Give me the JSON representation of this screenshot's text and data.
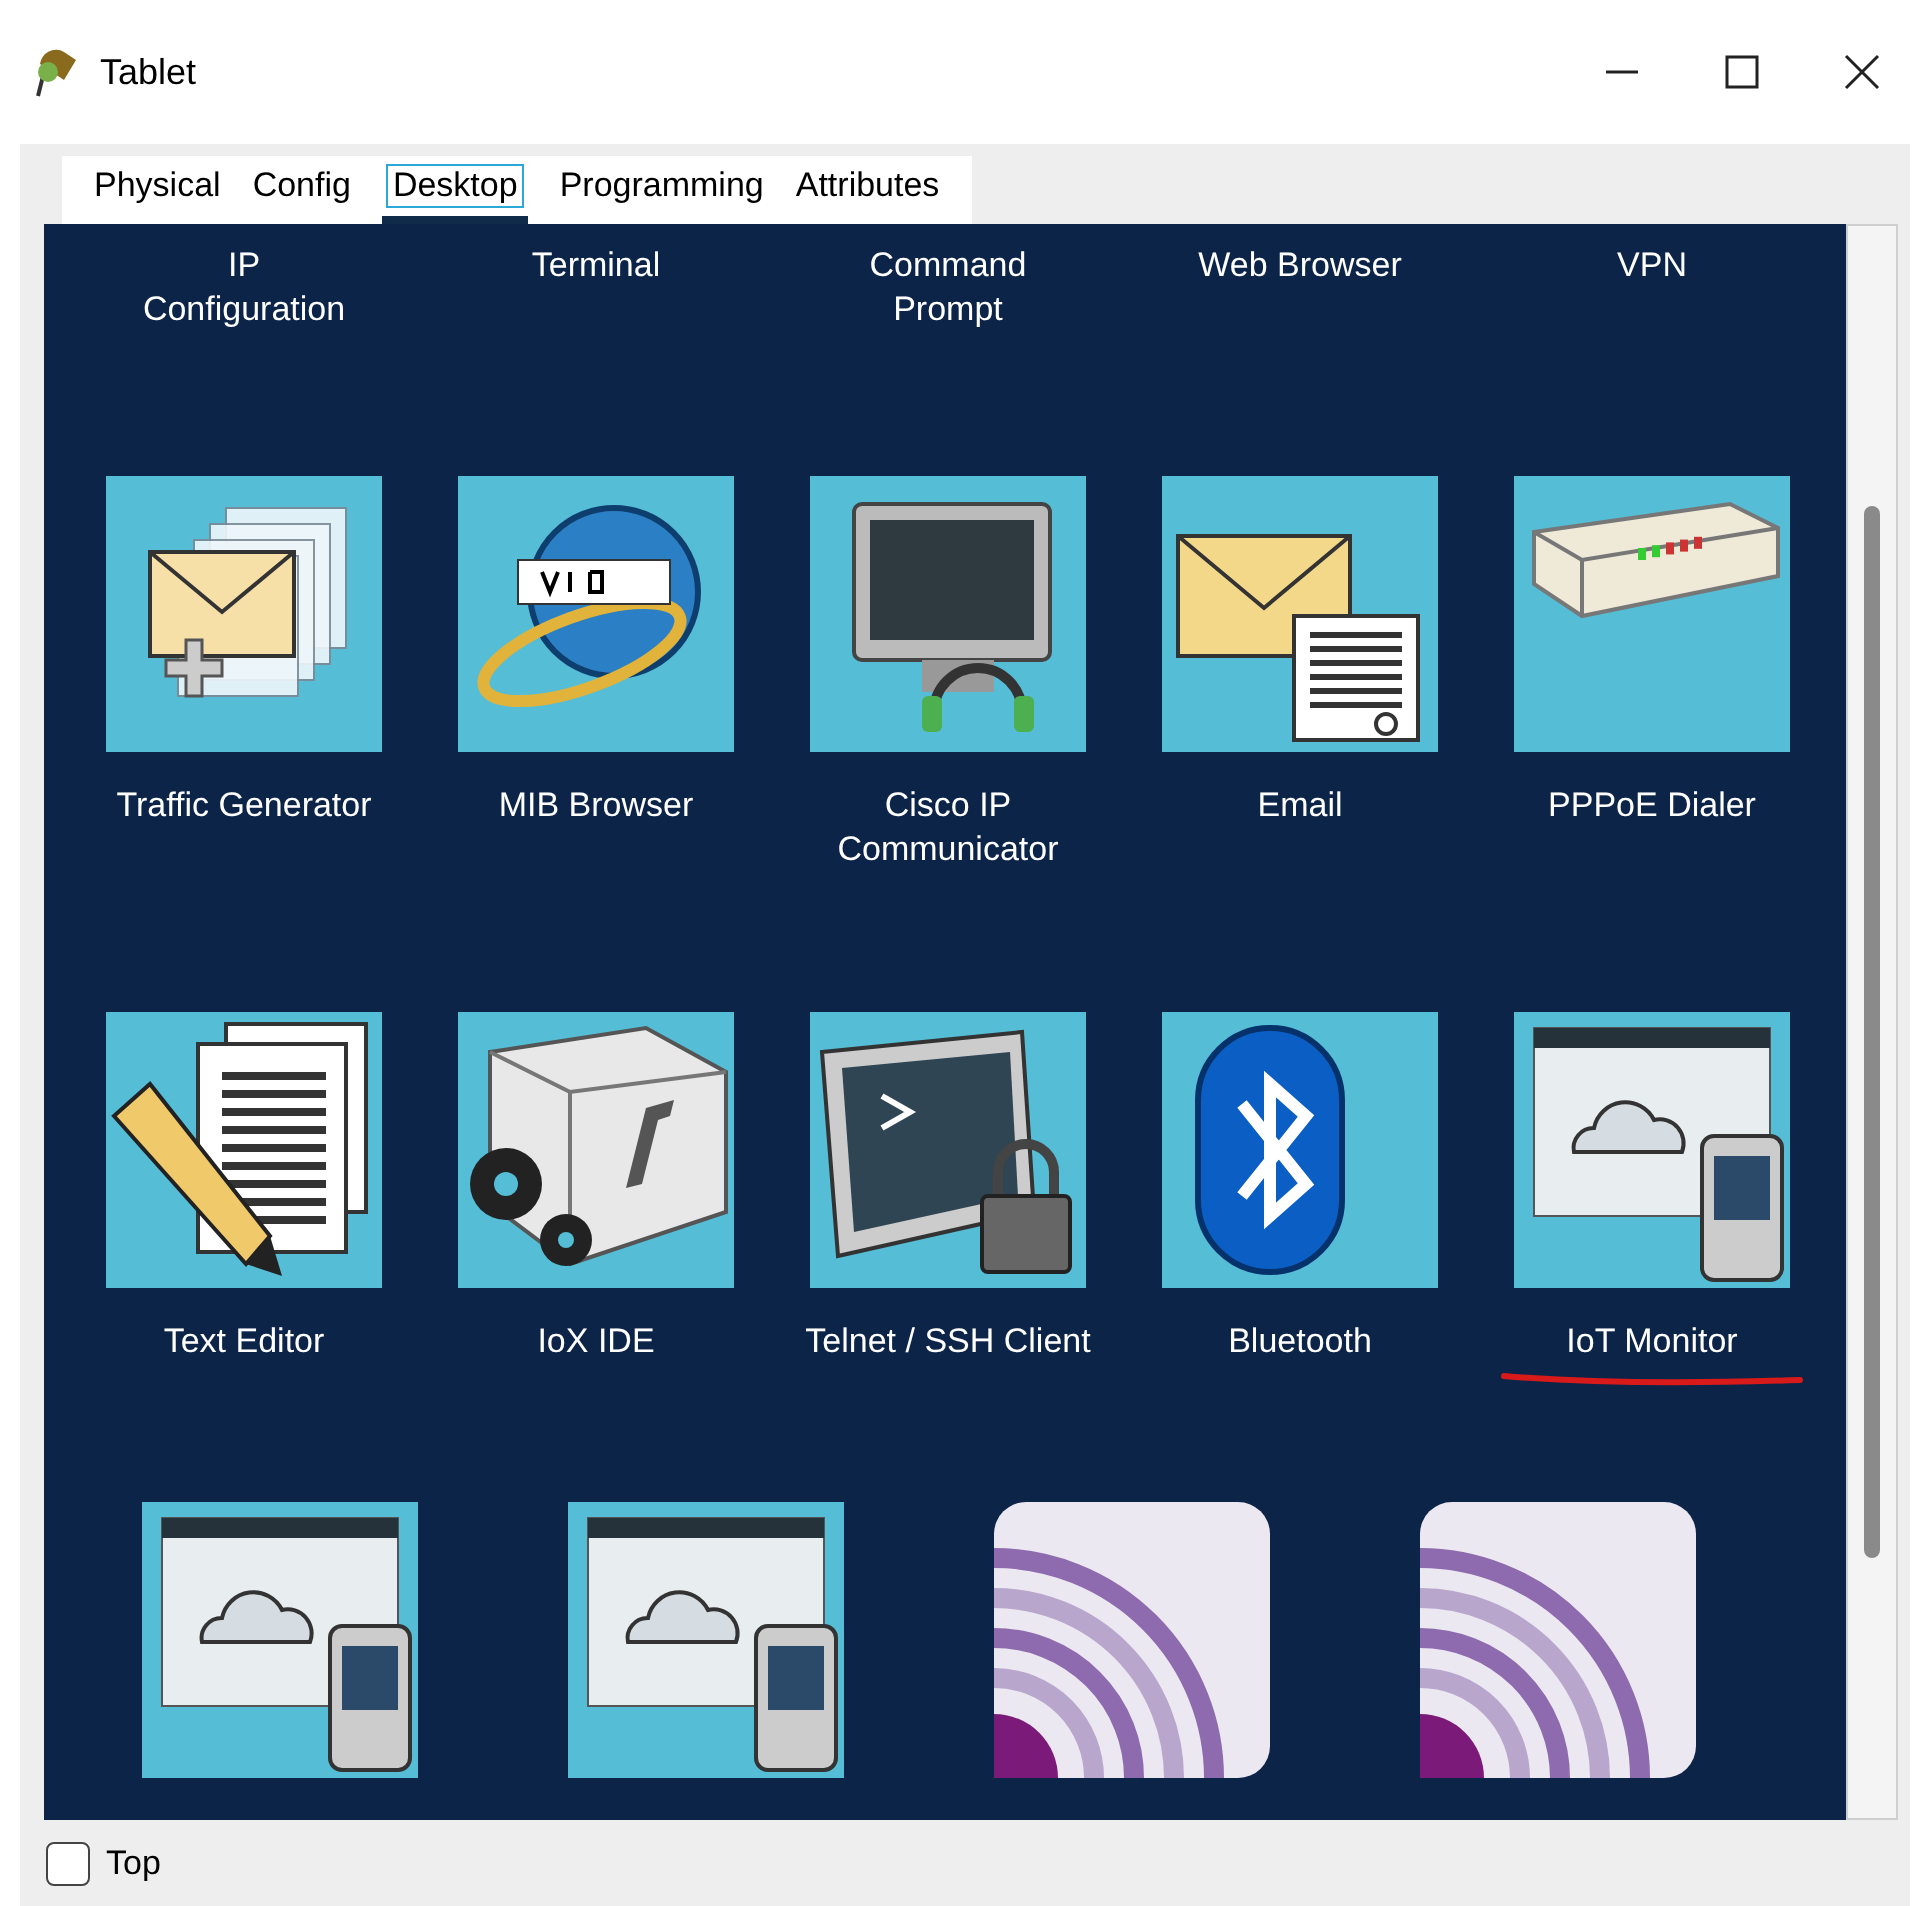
{
  "window": {
    "title": "Tablet"
  },
  "tabs": [
    {
      "label": "Physical",
      "selected": false
    },
    {
      "label": "Config",
      "selected": false
    },
    {
      "label": "Desktop",
      "selected": true
    },
    {
      "label": "Programming",
      "selected": false
    },
    {
      "label": "Attributes",
      "selected": false
    }
  ],
  "partial_row": [
    {
      "label": "IP\nConfiguration"
    },
    {
      "label": "Terminal"
    },
    {
      "label": "Command\nPrompt"
    },
    {
      "label": "Web Browser"
    },
    {
      "label": "VPN"
    }
  ],
  "app_rows": [
    [
      {
        "kind": "traffic",
        "label": "Traffic Generator",
        "underlined": false
      },
      {
        "kind": "mib",
        "label": "MIB Browser",
        "underlined": false
      },
      {
        "kind": "communicator",
        "label": "Cisco IP\nCommunicator",
        "underlined": false
      },
      {
        "kind": "email",
        "label": "Email",
        "underlined": false
      },
      {
        "kind": "modem",
        "label": "PPPoE Dialer",
        "underlined": false
      }
    ],
    [
      {
        "kind": "editor",
        "label": "Text Editor",
        "underlined": false
      },
      {
        "kind": "sdk",
        "label": "IoX IDE",
        "underlined": false
      },
      {
        "kind": "telnet",
        "label": "Telnet / SSH Client",
        "underlined": false
      },
      {
        "kind": "bluetooth",
        "label": "Bluetooth",
        "underlined": false
      },
      {
        "kind": "iot",
        "label": "IoT Monitor",
        "underlined": true
      }
    ]
  ],
  "bottom_row": [
    {
      "kind": "iot"
    },
    {
      "kind": "iot"
    },
    {
      "kind": "rings"
    },
    {
      "kind": "rings"
    }
  ],
  "top_checkbox": {
    "label": "Top",
    "checked": false
  }
}
